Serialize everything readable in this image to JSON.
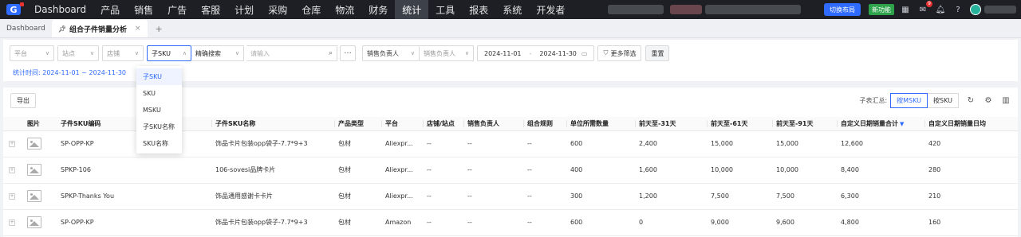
{
  "topbar": {
    "nav": [
      "Dashboard",
      "产品",
      "销售",
      "广告",
      "客服",
      "计划",
      "采购",
      "仓库",
      "物流",
      "财务",
      "统计",
      "工具",
      "报表",
      "系统",
      "开发者"
    ],
    "active_index": 10,
    "switch_label": "切换布局",
    "new_label": "新功能",
    "badge_count": "9"
  },
  "tabs": {
    "home": "Dashboard",
    "current": "组合子件销量分析",
    "add": "+"
  },
  "filters": {
    "platform": "平台",
    "site": "站点",
    "shop": "店铺",
    "sku_type": "子SKU",
    "match": "精确搜索",
    "search_placeholder": "请输入",
    "dots": "···",
    "salesperson_label": "销售负责人",
    "salesperson_placeholder": "销售负责人",
    "date_start": "2024-11-01",
    "date_sep": "-",
    "date_end": "2024-11-30",
    "more_filters": "更多筛选",
    "reset": "重置",
    "stat_time": "统计时间: 2024-11-01 ~ 2024-11-30"
  },
  "dropdown": {
    "options": [
      "子SKU",
      "SKU",
      "MSKU",
      "子SKU名称",
      "SKU名称"
    ],
    "selected": 0
  },
  "toolbar": {
    "export": "导出",
    "summary_label": "子表汇总:",
    "by_msku": "按MSKU",
    "by_sku": "按SKU"
  },
  "table": {
    "headers": [
      "图片",
      "子件SKU编码",
      "子件SKU名称",
      "产品类型",
      "平台",
      "店铺/站点",
      "销售负责人",
      "组合规则",
      "单位所需数量",
      "前天至-31天",
      "前天至-61天",
      "前天至-91天",
      "自定义日期销量合计",
      "自定义日期销量日均"
    ],
    "rows": [
      [
        "SP-OPP-KP",
        "饰品卡片包装opp袋子-7.7*9+3",
        "包材",
        "Aliexpr...",
        "--",
        "--",
        "--",
        "600",
        "2,400",
        "15,000",
        "15,000",
        "12,600",
        "420"
      ],
      [
        "SPKP-106",
        "106-sovesi品牌卡片",
        "包材",
        "Aliexpr...",
        "--",
        "--",
        "--",
        "400",
        "1,600",
        "10,000",
        "10,000",
        "8,400",
        "280"
      ],
      [
        "SPKP-Thanks You",
        "饰品通用感谢卡卡片",
        "包材",
        "Aliexpr...",
        "--",
        "--",
        "--",
        "300",
        "1,200",
        "7,500",
        "7,500",
        "6,300",
        "210"
      ],
      [
        "SP-OPP-KP",
        "饰品卡片包装opp袋子-7.7*9+3",
        "包材",
        "Amazon",
        "--",
        "--",
        "--",
        "600",
        "0",
        "9,000",
        "9,600",
        "4,800",
        "160"
      ]
    ]
  },
  "colors": {
    "topbar": "#1d1f24",
    "accent": "#2f6bff",
    "new_badge": "#2ca24a"
  }
}
